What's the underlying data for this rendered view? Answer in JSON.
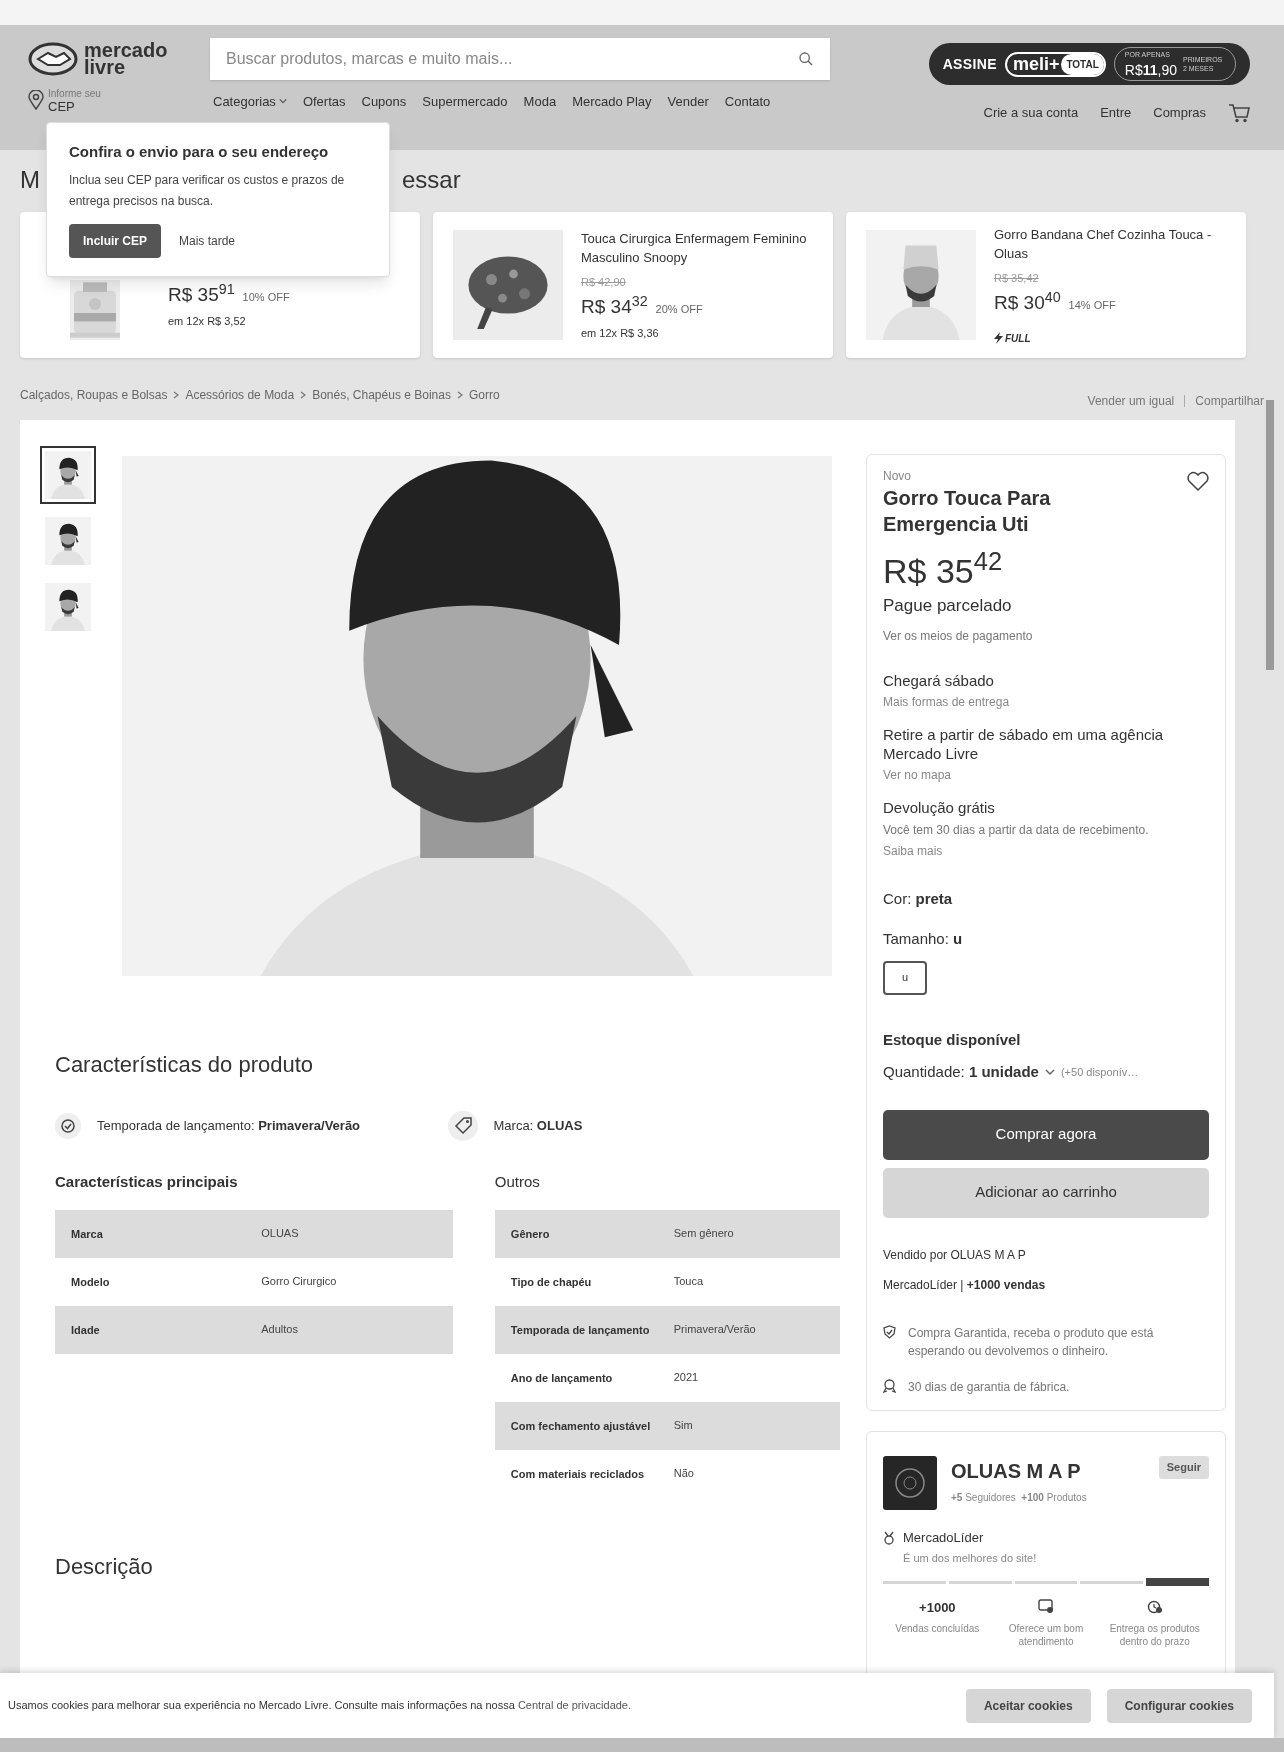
{
  "header": {
    "logo": {
      "line1": "mercado",
      "line2": "livre"
    },
    "search": {
      "placeholder": "Buscar produtos, marcas e muito mais..."
    },
    "promo": {
      "assine": "ASSINE",
      "brand": "meli+",
      "total": "TOTAL",
      "por_apenas": "POR APENAS",
      "price": "R$**11**,90",
      "months": "PRIMEIROS 2 MESES"
    },
    "location": {
      "line1": "Informe seu",
      "line2": "CEP"
    },
    "nav": [
      {
        "label": "Categorias",
        "dropdown": true
      },
      {
        "label": "Ofertas",
        "dropdown": false
      },
      {
        "label": "Cupons",
        "dropdown": false
      },
      {
        "label": "Supermercado",
        "dropdown": false
      },
      {
        "label": "Moda",
        "dropdown": false
      },
      {
        "label": "Mercado Play",
        "dropdown": false
      },
      {
        "label": "Vender",
        "dropdown": false
      },
      {
        "label": "Contato",
        "dropdown": false
      }
    ],
    "account": [
      "Crie a sua conta",
      "Entre",
      "Compras"
    ]
  },
  "popup": {
    "title": "Confira o envio para o seu endereço",
    "text": "Inclua seu CEP para verificar os custos e prazos de entrega precisos na busca.",
    "primary": "Incluir CEP",
    "secondary": "Mais tarde"
  },
  "section_title": {
    "start": "M",
    "end": "essar"
  },
  "recommendations": [
    {
      "price": "R$ 35$^{91}$",
      "discount": "10% OFF",
      "installments": "em 12x R$ 3,52",
      "full": false
    },
    {
      "title": "Touca Cirurgica Enfermagem Feminino Masculino Snoopy",
      "old_price": "R$ 42,90",
      "price": "R$ 34$^{32}$",
      "discount": "20% OFF",
      "installments": "em 12x R$ 3,36",
      "full": false
    },
    {
      "title": "Gorro Bandana Chef Cozinha Touca - Oluas",
      "old_price": "R$ 35,42",
      "price": "R$ 30$^{40}$",
      "discount": "14% OFF",
      "full": true,
      "full_label": "FULL"
    }
  ],
  "breadcrumb": [
    "Calçados, Roupas e Bolsas",
    "Acessórios de Moda",
    "Bonés, Chapéus e Boinas",
    "Gorro"
  ],
  "actions": [
    "Vender um igual",
    "Compartilhar"
  ],
  "thumbnails": [
    {
      "selected": true
    },
    {
      "selected": false
    },
    {
      "selected": false
    }
  ],
  "buy_box": {
    "condition": "Novo",
    "title": "Gorro Touca Para Emergencia Uti",
    "price": "R$ 35$^{42}$",
    "installments": "Pague parcelado",
    "payment_link": "Ver os meios de pagamento",
    "shipping": [
      {
        "title": "Chegará sábado",
        "link": "Mais formas de entrega"
      },
      {
        "title": "Retire a partir de sábado em uma agência Mercado Livre",
        "link": "Ver no mapa"
      },
      {
        "title": "Devolução grátis",
        "text": "Você tem 30 dias a partir da data de recebimento.",
        "link": "Saiba mais"
      }
    ],
    "color_label": "Cor: **preta**",
    "size_label": "Tamanho: **u**",
    "size_options": [
      {
        "label": "u",
        "selected": true
      }
    ],
    "stock": "Estoque disponível",
    "quantity": "Quantidade: **1 unidade**",
    "available": "(+50 disponív…",
    "buy": "Comprar agora",
    "cart": "Adicionar ao carrinho",
    "sold_by": "Vendido por OLUAS M A P",
    "seller_status": "MercadoLíder | **+1000 vendas**",
    "benefits": [
      {
        "kind": "shield",
        "text": "Compra Garantida, receba o produto que está esperando ou devolvemos o dinheiro."
      },
      {
        "kind": "medal",
        "text": "30 dias de garantia de fábrica."
      }
    ]
  },
  "seller": {
    "name": "OLUAS M A P",
    "follow": "Seguir",
    "stats": "**+5** Seguidores  **+100** Produtos",
    "badge": "MercadoLíder",
    "badge_text": "É um dos melhores do site!",
    "reputation": [
      {
        "selected": false
      },
      {
        "selected": false
      },
      {
        "selected": false
      },
      {
        "selected": false
      },
      {
        "selected": true
      }
    ],
    "metrics": [
      {
        "kind": "number",
        "value": "+1000",
        "label": "Vendas concluídas"
      },
      {
        "kind": "chat",
        "label": "Oferece um bom atendimento"
      },
      {
        "kind": "clock",
        "label": "Entrega os produtos dentro do prazo"
      }
    ]
  },
  "characteristics": {
    "title": "Características do produto",
    "highlights": [
      {
        "kind": "check",
        "text": "Temporada de lançamento: **Primavera/Verão**"
      },
      {
        "kind": "tag",
        "text": "Marca: **OLUAS**"
      }
    ],
    "tables": [
      {
        "title": "Características principais",
        "rows": [
          [
            "Marca",
            "OLUAS"
          ],
          [
            "Modelo",
            "Gorro Cirurgico"
          ],
          [
            "Idade",
            "Adultos"
          ]
        ]
      },
      {
        "title": "Outros",
        "rows": [
          [
            "Gênero",
            "Sem gênero"
          ],
          [
            "Tipo de chapéu",
            "Touca"
          ],
          [
            "Temporada de lançamento",
            "Primavera/Verão"
          ],
          [
            "Ano de lançamento",
            "2021"
          ],
          [
            "Com fechamento ajustável",
            "Sim"
          ],
          [
            "Com materiais reciclados",
            "Não"
          ]
        ]
      }
    ]
  },
  "description_title": "Descrição",
  "cookies": {
    "text": "Usamos cookies para melhorar sua experiência no Mercado Livre. Consulte mais informações na nossa ",
    "link": "Central de privacidade.",
    "accept": "Aceitar cookies",
    "configure": "Configurar cookies"
  }
}
